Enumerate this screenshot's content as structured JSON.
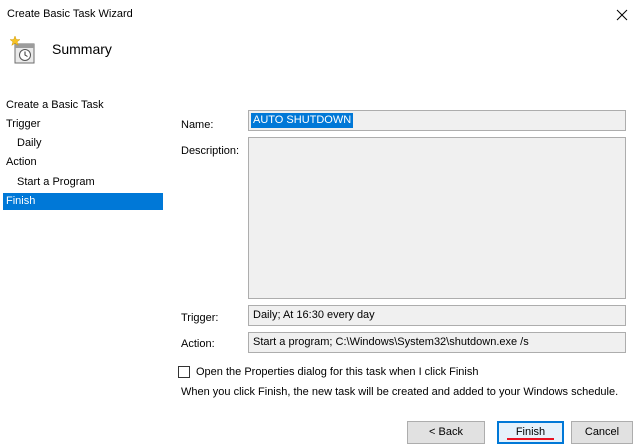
{
  "window": {
    "title": "Create Basic Task Wizard",
    "close_icon": "close-icon"
  },
  "header": {
    "icon": "task-clock-icon",
    "title": "Summary"
  },
  "sidebar": {
    "items": [
      {
        "label": "Create a Basic Task",
        "indent": 0,
        "selected": false
      },
      {
        "label": "Trigger",
        "indent": 0,
        "selected": false
      },
      {
        "label": "Daily",
        "indent": 1,
        "selected": false
      },
      {
        "label": "Action",
        "indent": 0,
        "selected": false
      },
      {
        "label": "Start a Program",
        "indent": 1,
        "selected": false
      },
      {
        "label": "Finish",
        "indent": 0,
        "selected": true
      }
    ]
  },
  "form": {
    "name_label": "Name:",
    "name_value": "AUTO SHUTDOWN",
    "description_label": "Description:",
    "description_value": "",
    "trigger_label": "Trigger:",
    "trigger_value": "Daily; At 16:30 every day",
    "action_label": "Action:",
    "action_value": "Start a program; C:\\Windows\\System32\\shutdown.exe /s"
  },
  "options": {
    "open_properties_label": "Open the Properties dialog for this task when I click Finish",
    "open_properties_checked": false,
    "info_text": "When you click Finish, the new task will be created and added to your Windows schedule."
  },
  "buttons": {
    "back": "< Back",
    "finish": "Finish",
    "cancel": "Cancel"
  },
  "colors": {
    "selection": "#0078d7",
    "field_bg": "#f0f0f0",
    "button_bg": "#e1e1e1",
    "finish_underline": "#e81123"
  }
}
